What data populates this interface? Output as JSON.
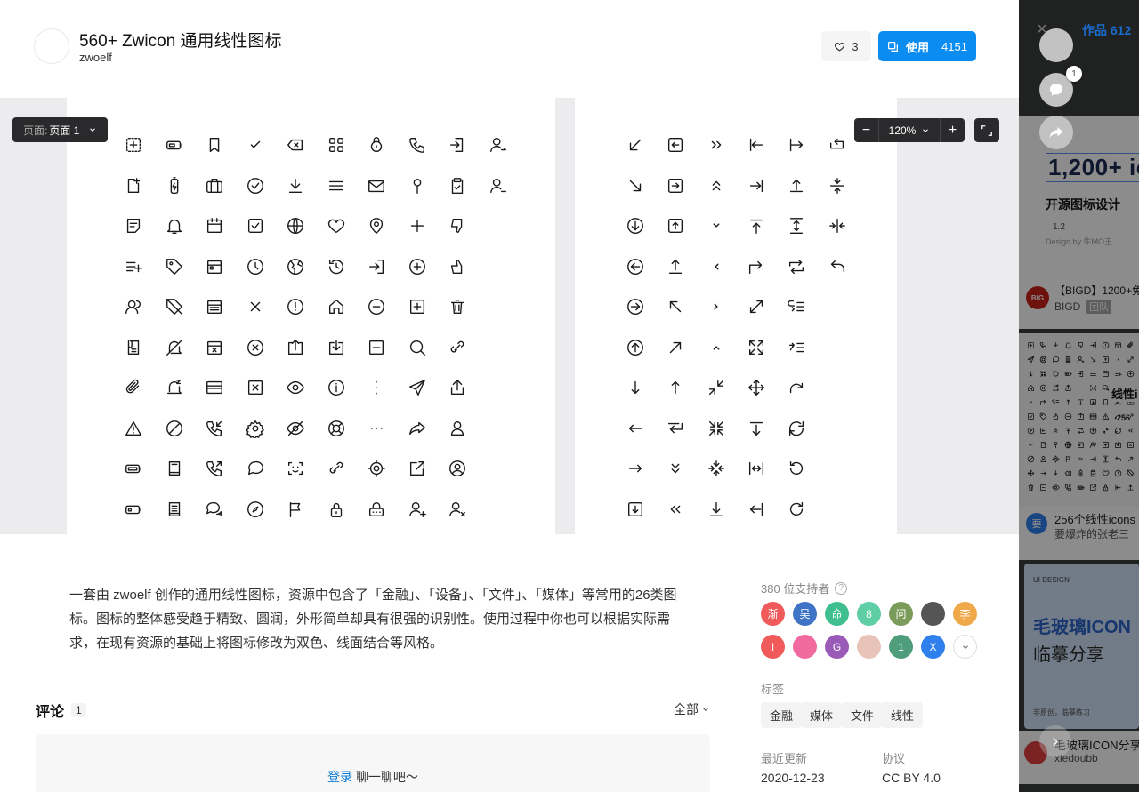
{
  "header": {
    "title": "560+ Zwicon 通用线性图标",
    "author": "zwoelf",
    "like_count": "3",
    "use_label": "使用",
    "use_count": "4151"
  },
  "preview": {
    "page_label": "页面:",
    "page_value": "页面 1",
    "zoom": "120%",
    "zoom_out": "−",
    "zoom_in": "+"
  },
  "description": "一套由 zwoelf 创作的通用线性图标，资源中包含了「金融」、「设备」、「文件」、「媒体」等常用的26类图标。图标的整体感受趋于精致、圆润，外形简单却具有很强的识别性。使用过程中你也可以根据实际需求，在现有资源的基础上将图标修改为双色、线面结合等风格。",
  "supporters": {
    "label": "380 位支持者",
    "avatars": [
      {
        "text": "渐",
        "color": "#f05a5a"
      },
      {
        "text": "吴",
        "color": "#3f73c6"
      },
      {
        "text": "命",
        "color": "#3fbf8f"
      },
      {
        "text": "8",
        "color": "#5fcda6"
      },
      {
        "text": "问",
        "color": "#7b9b5b"
      },
      {
        "text": "",
        "color": "#555555"
      },
      {
        "text": "李",
        "color": "#f0a94a"
      },
      {
        "text": "I",
        "color": "#f05a5a"
      },
      {
        "text": "",
        "color": "#f06aa0"
      },
      {
        "text": "G",
        "color": "#9a5bb8"
      },
      {
        "text": "",
        "color": "#e8c4b8"
      },
      {
        "text": "1",
        "color": "#4f9d7a"
      },
      {
        "text": "X",
        "color": "#2f80ed"
      }
    ]
  },
  "tags": {
    "label": "标签",
    "items": [
      "金融",
      "媒体",
      "文件",
      "线性"
    ]
  },
  "meta": {
    "updated_label": "最近更新",
    "updated_value": "2020-12-23",
    "license_label": "协议",
    "license_value": "CC BY 4.0"
  },
  "comments": {
    "title": "评论",
    "count": "1",
    "filter": "全部",
    "login": "登录",
    "prompt": "聊一聊吧～"
  },
  "side": {
    "works_label": "作品 612",
    "items": [
      {
        "title": "1,200+ ic",
        "subtitle": "开源图标设计",
        "version": "1.2",
        "credit": "Design by 牛MO王"
      },
      {
        "title": "【BIGD】1200+免",
        "author": "BIGD",
        "badge": "团队"
      },
      {
        "title": "256个线性icons",
        "author": "要爆炸的张老三",
        "preview_label": "线性i",
        "preview_num": "256"
      },
      {
        "title": "毛玻璃ICON分享",
        "author": "xiedoubb",
        "preview_tag": "UI DESIGN",
        "preview_title": "毛玻璃ICON",
        "preview_sub": "临摹分享",
        "preview_note": "非原创，临摹练习"
      }
    ],
    "comment_badge": "1"
  }
}
